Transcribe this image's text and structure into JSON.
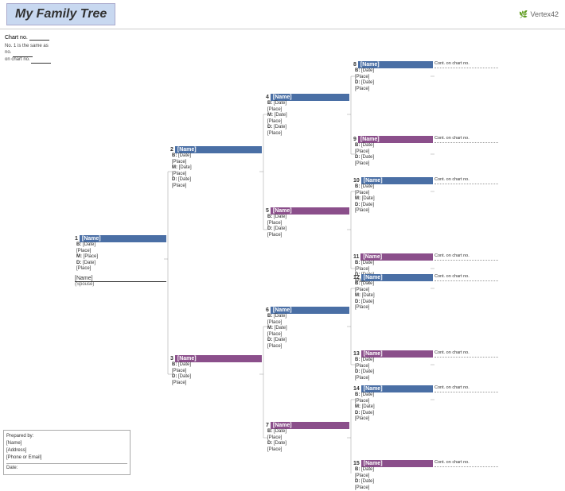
{
  "header": {
    "title": "My Family Tree",
    "logo_text": "Vertex42"
  },
  "chart_info": {
    "chart_no_label": "Chart no.",
    "note_line1": "No. 1 is the same as",
    "note_line2": "no.",
    "note_line3": "on chart no."
  },
  "persons": {
    "p1": {
      "number": "1",
      "name": "[Name]",
      "b_label": "B:",
      "b_date": "[Date]",
      "b_place": "[Place]",
      "m_label": "M:",
      "m_date": "[Place]",
      "d_label": "D:",
      "d_date": "[Date]",
      "d_place": "[Place]",
      "spouse_name": "[Name]",
      "spouse_label": "(Spouse)"
    },
    "p2": {
      "number": "2",
      "name": "[Name]",
      "b_label": "B:",
      "b_date": "[Date]",
      "b_place": "[Place]",
      "m_label": "M:",
      "m_date": "[Date]",
      "m_place": "[Place]",
      "d_label": "D:",
      "d_date": "[Date]",
      "d_place": "[Place]"
    },
    "p3": {
      "number": "3",
      "name": "[Name]",
      "b_label": "B:",
      "b_date": "[Date]",
      "b_place": "[Place]",
      "d_label": "D:",
      "d_date": "[Date]",
      "d_place": "[Place]"
    },
    "p4": {
      "number": "4",
      "name": "[Name]",
      "b_label": "B:",
      "b_date": "[Date]",
      "b_place": "[Place]",
      "m_label": "M:",
      "m_date": "[Date]",
      "m_place": "[Place]",
      "d_label": "D:",
      "d_date": "[Date]",
      "d_place": "[Place]"
    },
    "p5": {
      "number": "5",
      "name": "[Name]",
      "b_label": "B:",
      "b_date": "[Date]",
      "b_place": "[Place]",
      "d_label": "D:",
      "d_date": "[Date]",
      "d_place": "[Place]"
    },
    "p6": {
      "number": "6",
      "name": "[Name]",
      "b_label": "B:",
      "b_date": "[Date]",
      "b_place": "[Place]",
      "m_label": "M:",
      "m_date": "[Date]",
      "m_place": "[Place]",
      "d_label": "D:",
      "d_date": "[Date]",
      "d_place": "[Place]"
    },
    "p7": {
      "number": "7",
      "name": "[Name]",
      "b_label": "B:",
      "b_date": "[Date]",
      "b_place": "[Place]",
      "d_label": "D:",
      "d_date": "[Date]",
      "d_place": "[Place]"
    },
    "p8": {
      "number": "8",
      "name": "[Name]",
      "b_date": "[Date]",
      "b_place": "[Place]",
      "d_date": "[Date]",
      "d_place": "[Place]"
    },
    "p9": {
      "number": "9",
      "name": "[Name]",
      "b_date": "[Date]",
      "b_place": "[Place]",
      "d_date": "[Date]",
      "d_place": "[Place]"
    },
    "p10": {
      "number": "10",
      "name": "[Name]",
      "b_date": "[Date]",
      "b_place": "[Place]",
      "m_date": "[Date]",
      "d_date": "[Date]",
      "d_place": "[Place]"
    },
    "p11": {
      "number": "11",
      "name": "[Name]",
      "b_date": "[Date]",
      "b_place": "[Place]",
      "d_date": "[Date]",
      "d_place": "[Place]"
    },
    "p12": {
      "number": "12",
      "name": "[Name]",
      "b_date": "[Date]",
      "b_place": "[Place]",
      "m_date": "[Date]",
      "d_date": "[Date]",
      "d_place": "[Place]"
    },
    "p13": {
      "number": "13",
      "name": "[Name]",
      "b_date": "[Date]",
      "b_place": "[Place]",
      "d_date": "[Date]",
      "d_place": "[Place]"
    },
    "p14": {
      "number": "14",
      "name": "[Name]",
      "b_date": "[Date]",
      "b_place": "[Place]",
      "m_date": "[Date]",
      "d_date": "[Date]",
      "d_place": "[Place]"
    },
    "p15": {
      "number": "15",
      "name": "[Name]",
      "b_date": "[Date]",
      "b_place": "[Place]",
      "d_date": "[Date]",
      "d_place": "[Place]"
    }
  },
  "continue_note": "Cont. on chart no.",
  "footer": {
    "prepared_by_label": "Prepared by:",
    "name_label": "[Name]",
    "address_label": "[Address]",
    "phone_label": "[Phone or Email]",
    "date_label": "Date:"
  }
}
